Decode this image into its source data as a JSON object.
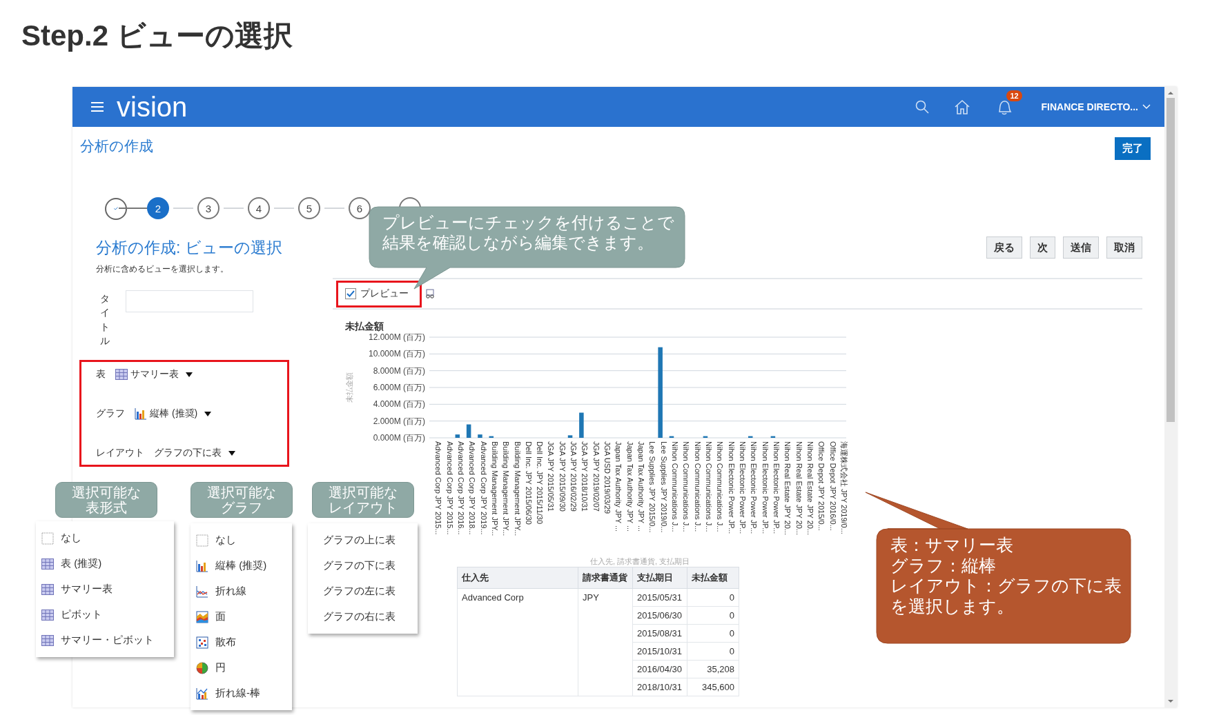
{
  "slide_title": "Step.2 ビューの選択",
  "app": {
    "logo": "vision",
    "notification_count": "12",
    "user_menu": "FINANCE DIRECTO..."
  },
  "page_title": "分析の作成",
  "done_button": "完了",
  "steps": [
    {
      "kind": "done"
    },
    {
      "number": "2",
      "kind": "current"
    },
    {
      "number": "3",
      "kind": "pending"
    },
    {
      "number": "4",
      "kind": "pending"
    },
    {
      "number": "5",
      "kind": "pending"
    },
    {
      "number": "6",
      "kind": "pending"
    },
    {
      "kind": "pending"
    }
  ],
  "heading": "分析の作成: ビューの選択",
  "subtitle": "分析に含めるビューを選択します。",
  "nav_buttons": [
    "戻る",
    "次",
    "送信",
    "取消"
  ],
  "title_label": "タイトル",
  "view_settings": [
    {
      "label": "表",
      "value": "サマリー表",
      "kind": "table"
    },
    {
      "label": "グラフ",
      "value": "縦棒 (推奨)",
      "kind": "bar"
    },
    {
      "label": "レイアウト",
      "value": "グラフの下に表",
      "kind": "plain"
    }
  ],
  "preview": {
    "label": "プレビュー",
    "checked": true
  },
  "chart": {
    "chart_data": {
      "type": "bar",
      "grid": true,
      "title": "未払金額",
      "xlabel": "仕入先, 請求書通貨, 支払期日",
      "ylabel": "未払金額",
      "categories": [
        "Advanced Corp JPY 2015...",
        "Advanced Corp JPY 2015...",
        "Advanced Corp JPY 2016...",
        "Advanced Corp JPY 2018...",
        "Advanced Corp JPY 2019...",
        "Building Management JPY...",
        "Building Management JPY...",
        "Building Management JPY...",
        "Dell Inc. JPY 2015/06/30",
        "Dell Inc. JPY 2015/11/30",
        "JGA JPY 2015/05/31",
        "JGA JPY 2015/09/30",
        "JGA JPY 2016/02/29",
        "JGA JPY 2018/10/31",
        "JGA JPY 2019/02/07",
        "JGA USD 2019/03/29",
        "Japan Tax Authority JPY ...",
        "Japan Tax Authority JPY ...",
        "Japan Tax Authority JPY ...",
        "Lee Supplies JPY 2015/0...",
        "Lee Supplies JPY 2019/0...",
        "Nihon Communications J...",
        "Nihon Communications J...",
        "Nihon Communications J...",
        "Nihon Communications J...",
        "Nihon Communications J...",
        "Nihon Electonic Power JP...",
        "Nihon Electonic Power JP...",
        "Nihon Electonic Power JP...",
        "Nihon Electonic Power JP...",
        "Nihon Electonic Power JP...",
        "Nihon Real Estate JPY 20...",
        "Nihon Real Estate JPY 20...",
        "Nihon Real Estate JPY 20...",
        "Office Depot JPY 2015/0...",
        "Office Depot JPY 2016/0...",
        "海運株式会社 JPY 2019/0..."
      ],
      "series": [
        {
          "color": "#1f77b4",
          "values": [
            0,
            0,
            0.4,
            1.6,
            0.4,
            0.2,
            0,
            0,
            0,
            0,
            0,
            0,
            0.3,
            3.0,
            0,
            0,
            0,
            0,
            0,
            0,
            10.8,
            0.2,
            0,
            0,
            0.2,
            0,
            0,
            0,
            0.2,
            0,
            0.2,
            0,
            0,
            0,
            0,
            0,
            0
          ]
        }
      ],
      "ylim": [
        0,
        12
      ],
      "yticks": [
        {
          "value": 12,
          "label": "12.000M (百万)"
        },
        {
          "value": 10,
          "label": "10.000M (百万)"
        },
        {
          "value": 8,
          "label": "8.000M (百万)"
        },
        {
          "value": 6,
          "label": "6.000M (百万)"
        },
        {
          "value": 4,
          "label": "4.000M (百万)"
        },
        {
          "value": 2,
          "label": "2.000M (百万)"
        },
        {
          "value": 0,
          "label": "0.000M (百万)"
        }
      ]
    }
  },
  "table": {
    "columns": [
      "仕入先",
      "請求書通貨",
      "支払期日",
      "未払金額"
    ],
    "groups": [
      {
        "vendor": "Advanced Corp",
        "currency": "JPY",
        "entries": [
          {
            "date": "2015/05/31",
            "amount": "0"
          },
          {
            "date": "2015/06/30",
            "amount": "0"
          },
          {
            "date": "2015/08/31",
            "amount": "0"
          },
          {
            "date": "2015/10/31",
            "amount": "0"
          },
          {
            "date": "2016/04/30",
            "amount": "35,208"
          },
          {
            "date": "2018/10/31",
            "amount": "345,600"
          }
        ]
      }
    ]
  },
  "annotations": {
    "preview_callout": [
      "プレビューにチェックを付けることで",
      "結果を確認しながら編集できます。"
    ],
    "summary_callout": [
      "表：サマリー表",
      "グラフ：縦棒",
      "レイアウト：グラフの下に表",
      "を選択します。"
    ],
    "option_panels": [
      {
        "label": [
          "選択可能な",
          "表形式"
        ],
        "items": [
          {
            "label": "なし",
            "kind": "none"
          },
          {
            "label": "表 (推奨)",
            "kind": "table"
          },
          {
            "label": "サマリー表",
            "kind": "table"
          },
          {
            "label": "ピボット",
            "kind": "table"
          },
          {
            "label": "サマリー・ピボット",
            "kind": "table"
          }
        ]
      },
      {
        "label": [
          "選択可能な",
          "グラフ"
        ],
        "items": [
          {
            "label": "なし",
            "kind": "none"
          },
          {
            "label": "縦棒 (推奨)",
            "kind": "bar"
          },
          {
            "label": "折れ線",
            "kind": "line"
          },
          {
            "label": "面",
            "kind": "area"
          },
          {
            "label": "散布",
            "kind": "scatter"
          },
          {
            "label": "円",
            "kind": "pie"
          },
          {
            "label": "折れ線-棒",
            "kind": "combo"
          }
        ]
      },
      {
        "label": [
          "選択可能な",
          "レイアウト"
        ],
        "items": [
          {
            "label": "グラフの上に表",
            "kind": "plain"
          },
          {
            "label": "グラフの下に表",
            "kind": "plain"
          },
          {
            "label": "グラフの左に表",
            "kind": "plain"
          },
          {
            "label": "グラフの右に表",
            "kind": "plain"
          }
        ]
      }
    ]
  }
}
